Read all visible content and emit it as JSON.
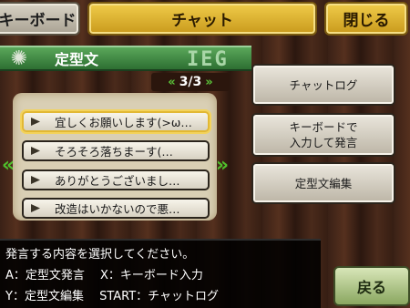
{
  "top_bar": {
    "keyboard_tab": "キーボード",
    "chat_tab": "チャット",
    "close_button": "閉じる"
  },
  "header": {
    "title": "定型文",
    "decoration": "IEG"
  },
  "pager": {
    "left_arrow": "«",
    "text": "3/3",
    "right_arrow": "»"
  },
  "phrases": [
    "宜しくお願いします(>ω…",
    "そろそろ落ちまーす(…",
    "ありがとうございまし…",
    "改造はいかないので悪…"
  ],
  "nav": {
    "left_arrow": "«",
    "right_arrow": "»"
  },
  "side_buttons": {
    "chat_log": "チャットログ",
    "keyboard_input_line1": "キーボードで",
    "keyboard_input_line2": "入力して発言",
    "edit_phrases": "定型文編集"
  },
  "message": {
    "line1": "発言する内容を選択してください。",
    "line2": "A：定型文発言　 X：キーボード入力",
    "line3": "Y：定型文編集　 START：チャットログ"
  },
  "back_button": "戻る",
  "colors": {
    "accent_gold": "#e7c13b",
    "header_green": "#3f8a43",
    "arrow_green": "#4fc02c"
  }
}
